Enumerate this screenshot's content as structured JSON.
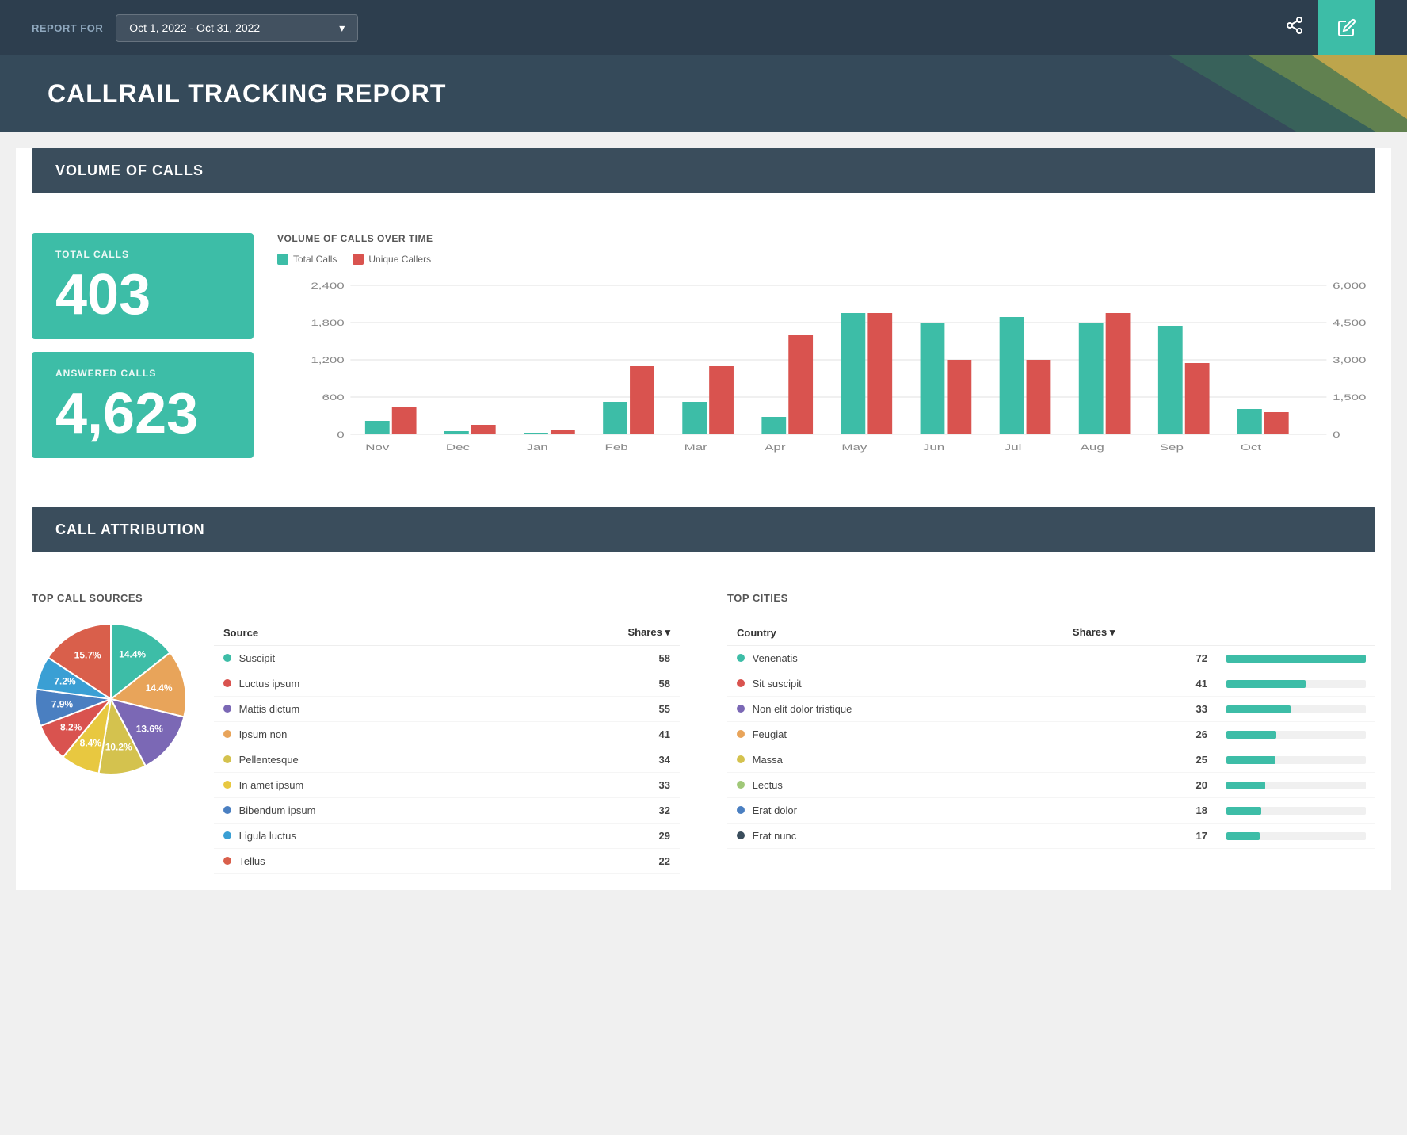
{
  "header": {
    "report_for_label": "REPORT FOR",
    "date_range": "Oct 1, 2022 - Oct 31, 2022",
    "share_icon": "⬡",
    "edit_icon": "✎"
  },
  "title": {
    "text": "CALLRAIL TRACKING REPORT"
  },
  "volume_section": {
    "header": "VOLUME OF CALLS",
    "total_calls_label": "TOTAL CALLS",
    "total_calls_value": "403",
    "answered_calls_label": "ANSWERED CALLS",
    "answered_calls_value": "4,623",
    "chart_title": "VOLUME OF CALLS OVER TIME",
    "legend": {
      "total_calls": "Total Calls",
      "unique_callers": "Unique Callers"
    },
    "chart_data": {
      "months": [
        "Nov",
        "Dec",
        "Jan",
        "Feb",
        "Mar",
        "Apr",
        "May",
        "Jun",
        "Jul",
        "Aug",
        "Sep",
        "Oct"
      ],
      "total_calls": [
        200,
        50,
        30,
        500,
        500,
        280,
        1950,
        1800,
        1900,
        1800,
        1750,
        400
      ],
      "unique_callers": [
        450,
        100,
        60,
        1100,
        1100,
        1600,
        1950,
        1200,
        1200,
        1950,
        1150,
        350
      ],
      "left_y_axis": [
        "2,400",
        "1,800",
        "1,200",
        "600",
        "0"
      ],
      "right_y_axis": [
        "6,000",
        "4,500",
        "3,000",
        "1,500",
        "0"
      ]
    }
  },
  "attribution_section": {
    "header": "CALL ATTRIBUTION",
    "top_call_sources_label": "TOP CALL SOURCES",
    "top_cities_label": "TOP CITIES",
    "sources_table": {
      "col_source": "Source",
      "col_shares": "Shares",
      "rows": [
        {
          "label": "Suscipit",
          "color": "#3dbda7",
          "value": 58
        },
        {
          "label": "Luctus ipsum",
          "color": "#d9534f",
          "value": 58
        },
        {
          "label": "Mattis dictum",
          "color": "#7b68b5",
          "value": 55
        },
        {
          "label": "Ipsum non",
          "color": "#e8a45a",
          "value": 41
        },
        {
          "label": "Pellentesque",
          "color": "#d4c24e",
          "value": 34
        },
        {
          "label": "In amet ipsum",
          "color": "#e8c840",
          "value": 33
        },
        {
          "label": "Bibendum ipsum",
          "color": "#4a7fc1",
          "value": 32
        },
        {
          "label": "Ligula luctus",
          "color": "#3a9fd4",
          "value": 29
        },
        {
          "label": "Tellus",
          "color": "#d95f4b",
          "value": 22
        }
      ]
    },
    "cities_table": {
      "col_country": "Country",
      "col_shares": "Shares",
      "rows": [
        {
          "label": "Venenatis",
          "color": "#3dbda7",
          "value": 72,
          "pct": 100
        },
        {
          "label": "Sit suscipit",
          "color": "#d9534f",
          "value": 41,
          "pct": 57
        },
        {
          "label": "Non elit dolor tristique",
          "color": "#7b68b5",
          "value": 33,
          "pct": 46
        },
        {
          "label": "Feugiat",
          "color": "#e8a45a",
          "value": 26,
          "pct": 36
        },
        {
          "label": "Massa",
          "color": "#d4c24e",
          "value": 25,
          "pct": 35
        },
        {
          "label": "Lectus",
          "color": "#a0c878",
          "value": 20,
          "pct": 28
        },
        {
          "label": "Erat dolor",
          "color": "#4a7fc1",
          "value": 18,
          "pct": 25
        },
        {
          "label": "Erat nunc",
          "color": "#3a4d5c",
          "value": 17,
          "pct": 24
        }
      ]
    },
    "pie_segments": [
      {
        "label": "14.4%",
        "color": "#3dbda7",
        "pct": 14.4
      },
      {
        "label": "14.4%",
        "color": "#e8a45a",
        "pct": 14.4
      },
      {
        "label": "13.6%",
        "color": "#7b68b5",
        "pct": 13.6
      },
      {
        "label": "10.2%",
        "color": "#d4c24e",
        "pct": 10.2
      },
      {
        "label": "8.4%",
        "color": "#e8c840",
        "pct": 8.4
      },
      {
        "label": "8.2%",
        "color": "#d9534f",
        "pct": 8.2
      },
      {
        "label": "7.9%",
        "color": "#4a7fc1",
        "pct": 7.9
      },
      {
        "label": "7.2%",
        "color": "#3a9fd4",
        "pct": 7.2
      },
      {
        "label": "15.7%",
        "color": "#d95f4b",
        "pct": 15.7
      }
    ]
  }
}
